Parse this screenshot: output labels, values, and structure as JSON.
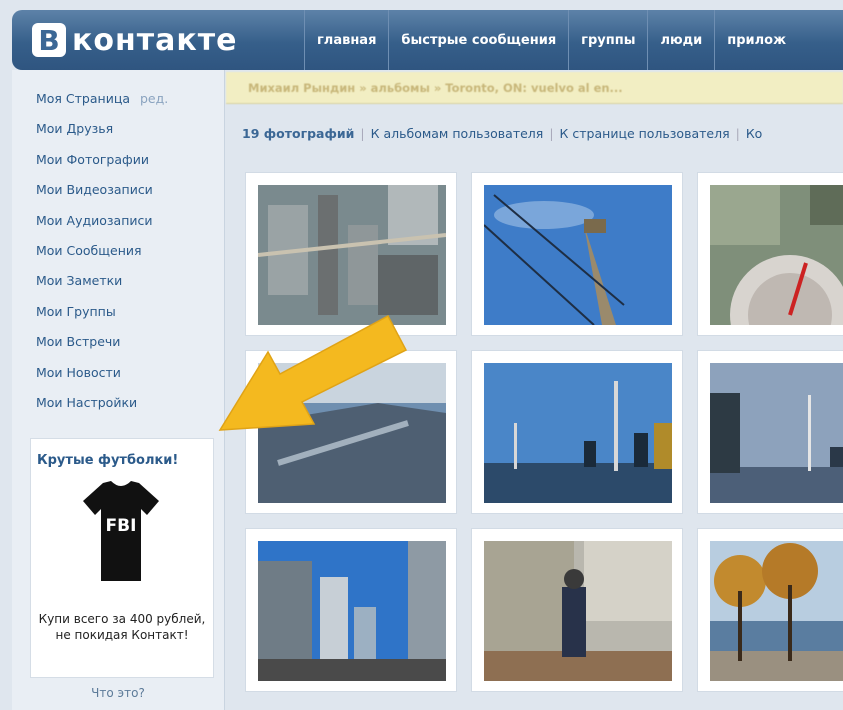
{
  "header": {
    "logo_letter": "В",
    "logo_text": "контакте",
    "nav": [
      "главная",
      "быстрые сообщения",
      "группы",
      "люди",
      "прилож"
    ]
  },
  "sidebar": {
    "items": [
      {
        "label": "Моя Страница",
        "extra": "ред."
      },
      {
        "label": "Мои Друзья"
      },
      {
        "label": "Мои Фотографии"
      },
      {
        "label": "Мои Видеозаписи"
      },
      {
        "label": "Мои Аудиозаписи"
      },
      {
        "label": "Мои Сообщения"
      },
      {
        "label": "Мои Заметки"
      },
      {
        "label": "Мои Группы"
      },
      {
        "label": "Мои Встречи"
      },
      {
        "label": "Мои Новости"
      },
      {
        "label": "Мои Настройки"
      }
    ],
    "ad": {
      "title": "Крутые футболки!",
      "shirt_text": "FBI",
      "text": "Купи всего за 400 рублей, не покидая Контакт!"
    },
    "whatis": "Что это?"
  },
  "breadcrumb": "Михаил Рындин » альбомы » Toronto, ON: vuelvo al en...",
  "toolbar": {
    "count": "19 фотографий",
    "links": [
      "К альбомам пользователя",
      "К странице пользователя",
      "Ко"
    ]
  },
  "photos": [
    {
      "desc": "aerial-city-view-icon"
    },
    {
      "desc": "cn-tower-sky-icon"
    },
    {
      "desc": "cn-tower-top-down-icon"
    },
    {
      "desc": "city-harbor-aerial-icon"
    },
    {
      "desc": "toronto-skyline-icon"
    },
    {
      "desc": "skyline-dusk-icon"
    },
    {
      "desc": "condo-towers-icon"
    },
    {
      "desc": "person-by-building-icon"
    },
    {
      "desc": "lakeshore-trees-icon"
    }
  ],
  "colors": {
    "header": "#365f8a",
    "link": "#2b5a8a",
    "arrow": "#f4b91f"
  }
}
